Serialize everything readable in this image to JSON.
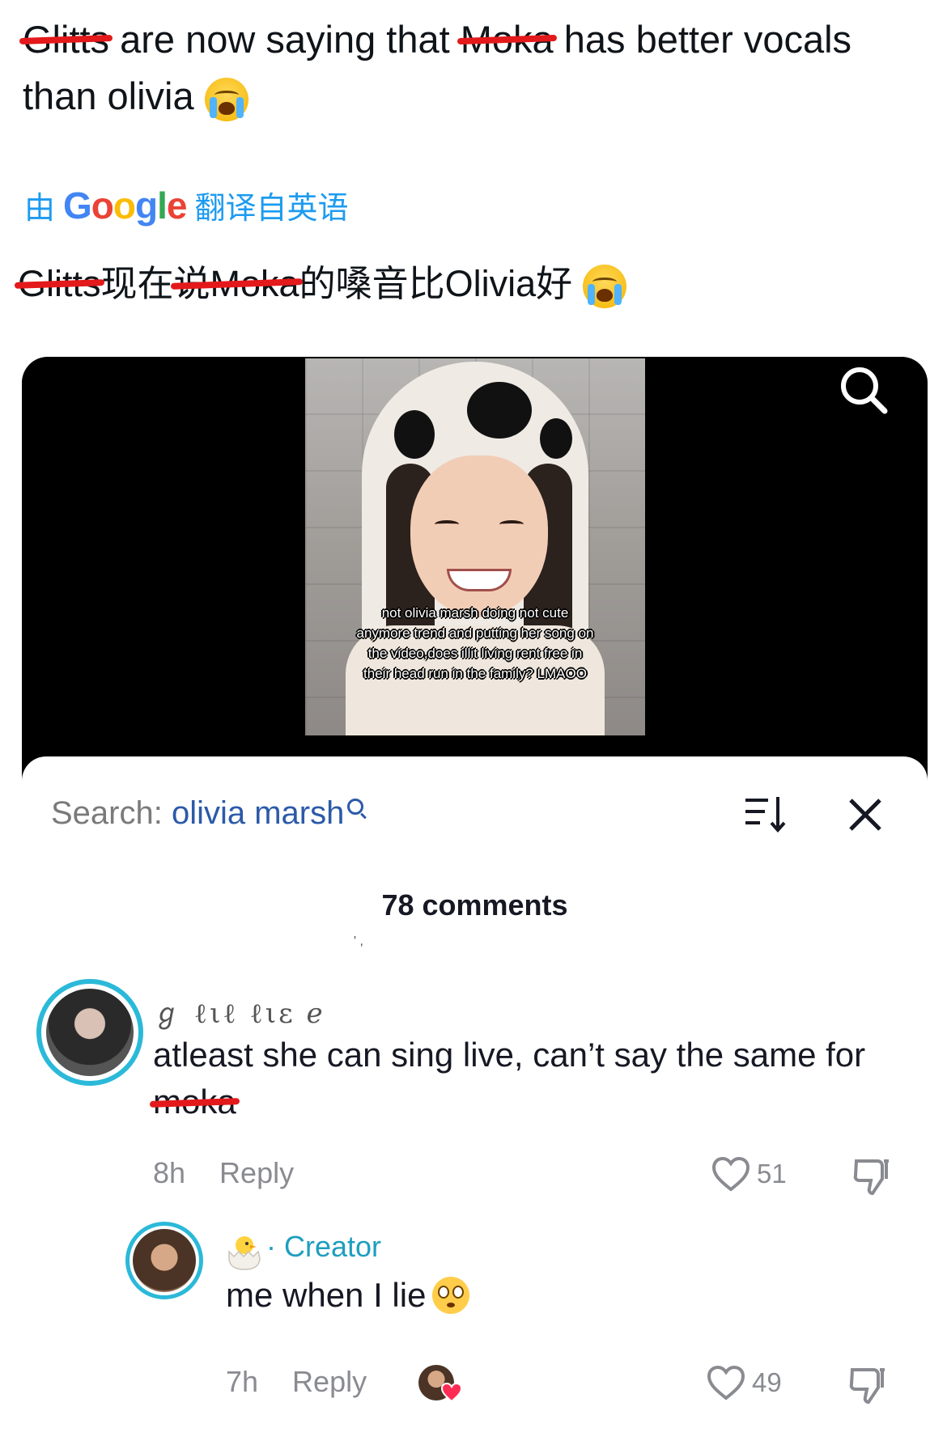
{
  "tweet": {
    "word1": "Glitts",
    "part1": " are now saying that ",
    "word2": "Moka",
    "part2": " has better vocals than olivia"
  },
  "translation": {
    "prefix": "由",
    "brand": "Google",
    "suffix": "翻译自英语",
    "word1": "Glitts",
    "part1": "现在",
    "word2": "说Moka",
    "part2": "的嗓音比Olivia好"
  },
  "video": {
    "caption": "not olivia marsh doing not cute anymore trend and putting her song on the video,does illit living rent free in their head run in the family? LMAOO"
  },
  "comments_panel": {
    "search_label": "Search: ",
    "search_term": "olivia marsh",
    "count_label": "78 comments",
    "comment": {
      "username": "ℊ ℓιℓ ℓιε ℯ",
      "text_part1": "atleast she can sing live, can’t say the same for ",
      "text_struck": "moka",
      "time": "8h",
      "reply_label": "Reply",
      "likes": "51"
    },
    "reply": {
      "badge": "· Creator",
      "text": "me when I lie",
      "time": "7h",
      "reply_label": "Reply",
      "likes": "49"
    }
  },
  "icons": [
    "loudly-crying-emoji",
    "search-icon",
    "sort-icon",
    "close-icon",
    "heart-icon",
    "dislike-icon",
    "hatching-chick-emoji",
    "flushed-face-emoji"
  ],
  "colors": {
    "accent_blue": "#1d9bf0",
    "creator_teal": "#1e9ebf",
    "redaction_red": "#e3191b"
  }
}
